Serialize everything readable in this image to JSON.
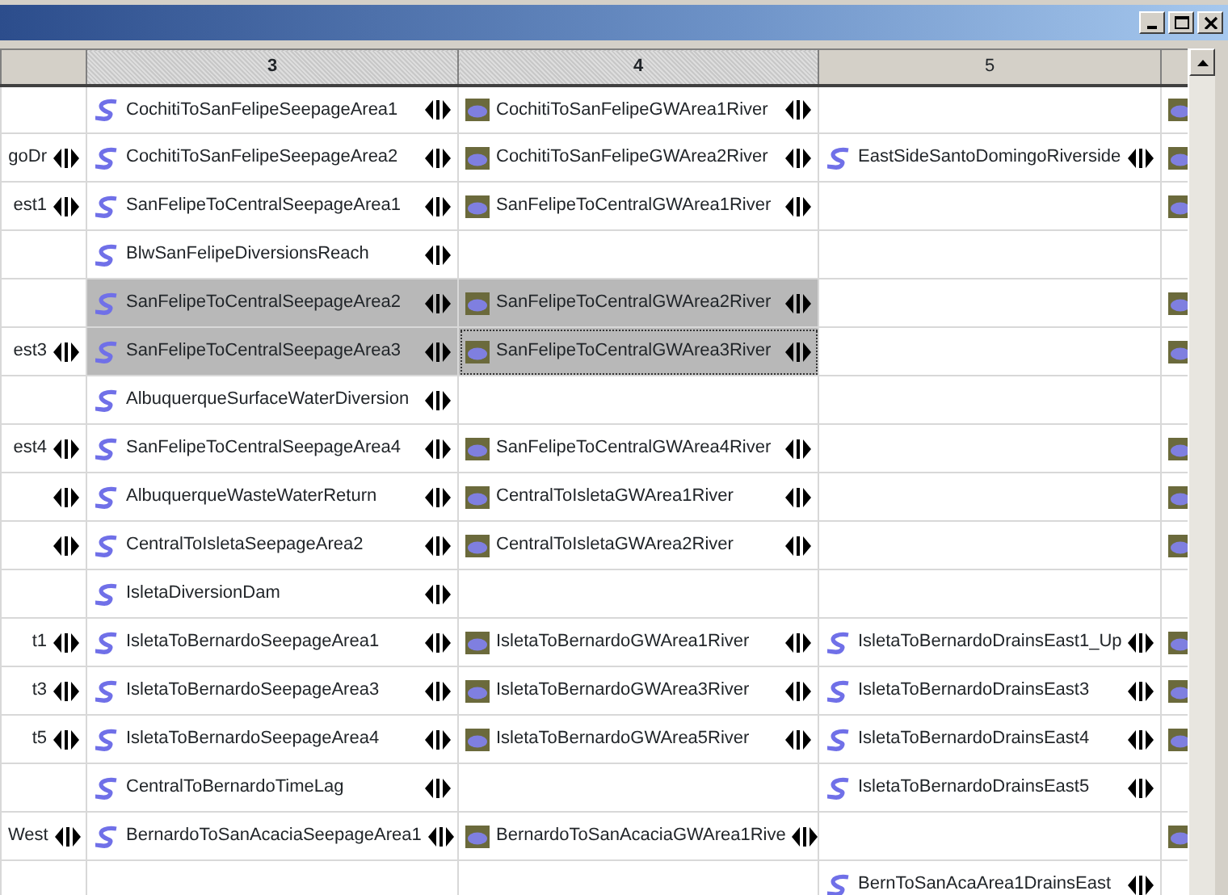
{
  "window": {
    "controls": [
      {
        "kind": "minimize"
      },
      {
        "kind": "maximize"
      },
      {
        "kind": "close"
      }
    ]
  },
  "table": {
    "columns": [
      {
        "selected": false
      },
      {
        "label": "3",
        "selected": true
      },
      {
        "label": "4",
        "selected": true
      },
      {
        "label": "5",
        "selected": false
      },
      {
        "selected": false
      }
    ],
    "rows": [
      {
        "cells": [
          {
            "kind": "empty",
            "selected": false,
            "focused": false
          },
          {
            "kind": "reach",
            "label": "CochitiToSanFelipeSeepageArea1",
            "selected": false,
            "focused": false
          },
          {
            "kind": "groundwater",
            "label": "CochitiToSanFelipeGWArea1River",
            "selected": false,
            "focused": false
          },
          {
            "kind": "empty",
            "selected": false,
            "focused": false
          },
          {
            "kind": "groundwater-icon",
            "selected": false,
            "focused": false
          }
        ]
      },
      {
        "cells": [
          {
            "kind": "text",
            "label": "goDr",
            "selected": false,
            "focused": false
          },
          {
            "kind": "reach",
            "label": "CochitiToSanFelipeSeepageArea2",
            "selected": false,
            "focused": false
          },
          {
            "kind": "groundwater",
            "label": "CochitiToSanFelipeGWArea2River",
            "selected": false,
            "focused": false
          },
          {
            "kind": "reach",
            "label": "EastSideSantoDomingoRiverside",
            "selected": false,
            "focused": false
          },
          {
            "kind": "groundwater-icon",
            "selected": false,
            "focused": false
          }
        ]
      },
      {
        "cells": [
          {
            "kind": "text",
            "label": "est1",
            "selected": false,
            "focused": false
          },
          {
            "kind": "reach",
            "label": "SanFelipeToCentralSeepageArea1",
            "selected": false,
            "focused": false
          },
          {
            "kind": "groundwater",
            "label": "SanFelipeToCentralGWArea1River",
            "selected": false,
            "focused": false
          },
          {
            "kind": "empty",
            "selected": false,
            "focused": false
          },
          {
            "kind": "groundwater-icon",
            "selected": false,
            "focused": false
          }
        ]
      },
      {
        "cells": [
          {
            "kind": "empty",
            "selected": false,
            "focused": false
          },
          {
            "kind": "reach",
            "label": "BlwSanFelipeDiversionsReach",
            "selected": false,
            "focused": false
          },
          {
            "kind": "empty",
            "selected": false,
            "focused": false
          },
          {
            "kind": "empty",
            "selected": false,
            "focused": false
          },
          {
            "kind": "empty",
            "selected": false,
            "focused": false
          }
        ]
      },
      {
        "cells": [
          {
            "kind": "empty",
            "selected": false,
            "focused": false
          },
          {
            "kind": "reach",
            "label": "SanFelipeToCentralSeepageArea2",
            "selected": true,
            "focused": false
          },
          {
            "kind": "groundwater",
            "label": "SanFelipeToCentralGWArea2River",
            "selected": true,
            "focused": false
          },
          {
            "kind": "empty",
            "selected": false,
            "focused": false
          },
          {
            "kind": "groundwater-icon",
            "selected": false,
            "focused": false
          }
        ]
      },
      {
        "cells": [
          {
            "kind": "text",
            "label": "est3",
            "selected": false,
            "focused": false
          },
          {
            "kind": "reach",
            "label": "SanFelipeToCentralSeepageArea3",
            "selected": true,
            "focused": false
          },
          {
            "kind": "groundwater",
            "label": "SanFelipeToCentralGWArea3River",
            "selected": true,
            "focused": true
          },
          {
            "kind": "empty",
            "selected": false,
            "focused": false
          },
          {
            "kind": "groundwater-icon",
            "selected": false,
            "focused": false
          }
        ]
      },
      {
        "cells": [
          {
            "kind": "empty",
            "selected": false,
            "focused": false
          },
          {
            "kind": "reach",
            "label": "AlbuquerqueSurfaceWaterDiversion",
            "selected": false,
            "focused": false
          },
          {
            "kind": "empty",
            "selected": false,
            "focused": false
          },
          {
            "kind": "empty",
            "selected": false,
            "focused": false
          },
          {
            "kind": "empty",
            "selected": false,
            "focused": false
          }
        ]
      },
      {
        "cells": [
          {
            "kind": "text",
            "label": "est4",
            "selected": false,
            "focused": false
          },
          {
            "kind": "reach",
            "label": "SanFelipeToCentralSeepageArea4",
            "selected": false,
            "focused": false
          },
          {
            "kind": "groundwater",
            "label": "SanFelipeToCentralGWArea4River",
            "selected": false,
            "focused": false
          },
          {
            "kind": "empty",
            "selected": false,
            "focused": false
          },
          {
            "kind": "groundwater-icon",
            "selected": false,
            "focused": false
          }
        ]
      },
      {
        "cells": [
          {
            "kind": "arrows",
            "selected": false,
            "focused": false
          },
          {
            "kind": "reach",
            "label": "AlbuquerqueWasteWaterReturn",
            "selected": false,
            "focused": false
          },
          {
            "kind": "groundwater",
            "label": "CentralToIsletaGWArea1River",
            "selected": false,
            "focused": false
          },
          {
            "kind": "empty",
            "selected": false,
            "focused": false
          },
          {
            "kind": "groundwater-icon",
            "selected": false,
            "focused": false
          }
        ]
      },
      {
        "cells": [
          {
            "kind": "arrows",
            "selected": false,
            "focused": false
          },
          {
            "kind": "reach",
            "label": "CentralToIsletaSeepageArea2",
            "selected": false,
            "focused": false
          },
          {
            "kind": "groundwater",
            "label": "CentralToIsletaGWArea2River",
            "selected": false,
            "focused": false
          },
          {
            "kind": "empty",
            "selected": false,
            "focused": false
          },
          {
            "kind": "groundwater-icon",
            "selected": false,
            "focused": false
          }
        ]
      },
      {
        "cells": [
          {
            "kind": "empty",
            "selected": false,
            "focused": false
          },
          {
            "kind": "reach",
            "label": "IsletaDiversionDam",
            "selected": false,
            "focused": false
          },
          {
            "kind": "empty",
            "selected": false,
            "focused": false
          },
          {
            "kind": "empty",
            "selected": false,
            "focused": false
          },
          {
            "kind": "empty",
            "selected": false,
            "focused": false
          }
        ]
      },
      {
        "cells": [
          {
            "kind": "text",
            "label": "t1",
            "selected": false,
            "focused": false
          },
          {
            "kind": "reach",
            "label": "IsletaToBernardoSeepageArea1",
            "selected": false,
            "focused": false
          },
          {
            "kind": "groundwater",
            "label": "IsletaToBernardoGWArea1River",
            "selected": false,
            "focused": false
          },
          {
            "kind": "reach",
            "label": "IsletaToBernardoDrainsEast1_Up",
            "selected": false,
            "focused": false
          },
          {
            "kind": "groundwater-icon",
            "selected": false,
            "focused": false
          }
        ]
      },
      {
        "cells": [
          {
            "kind": "text",
            "label": "t3",
            "selected": false,
            "focused": false
          },
          {
            "kind": "reach",
            "label": "IsletaToBernardoSeepageArea3",
            "selected": false,
            "focused": false
          },
          {
            "kind": "groundwater",
            "label": "IsletaToBernardoGWArea3River",
            "selected": false,
            "focused": false
          },
          {
            "kind": "reach",
            "label": "IsletaToBernardoDrainsEast3",
            "selected": false,
            "focused": false
          },
          {
            "kind": "groundwater-icon",
            "selected": false,
            "focused": false
          }
        ]
      },
      {
        "cells": [
          {
            "kind": "text",
            "label": "t5",
            "selected": false,
            "focused": false
          },
          {
            "kind": "reach",
            "label": "IsletaToBernardoSeepageArea4",
            "selected": false,
            "focused": false
          },
          {
            "kind": "groundwater",
            "label": "IsletaToBernardoGWArea5River",
            "selected": false,
            "focused": false
          },
          {
            "kind": "reach",
            "label": "IsletaToBernardoDrainsEast4",
            "selected": false,
            "focused": false
          },
          {
            "kind": "groundwater-icon",
            "selected": false,
            "focused": false
          }
        ]
      },
      {
        "cells": [
          {
            "kind": "empty",
            "selected": false,
            "focused": false
          },
          {
            "kind": "reach",
            "label": "CentralToBernardoTimeLag",
            "selected": false,
            "focused": false
          },
          {
            "kind": "empty",
            "selected": false,
            "focused": false
          },
          {
            "kind": "reach",
            "label": "IsletaToBernardoDrainsEast5",
            "selected": false,
            "focused": false
          },
          {
            "kind": "empty",
            "selected": false,
            "focused": false
          }
        ]
      },
      {
        "cells": [
          {
            "kind": "text",
            "label": "West",
            "selected": false,
            "focused": false
          },
          {
            "kind": "reach",
            "label": "BernardoToSanAcaciaSeepageArea1",
            "selected": false,
            "focused": false
          },
          {
            "kind": "groundwater",
            "label": "BernardoToSanAcaciaGWArea1Rive",
            "selected": false,
            "focused": false
          },
          {
            "kind": "empty",
            "selected": false,
            "focused": false
          },
          {
            "kind": "groundwater-icon",
            "selected": false,
            "focused": false
          }
        ]
      },
      {
        "cells": [
          {
            "kind": "empty",
            "selected": false,
            "focused": false
          },
          {
            "kind": "empty",
            "selected": false,
            "focused": false
          },
          {
            "kind": "empty",
            "selected": false,
            "focused": false
          },
          {
            "kind": "reach",
            "label": "BernToSanAcaArea1DrainsEast",
            "selected": false,
            "focused": false
          },
          {
            "kind": "empty",
            "selected": false,
            "focused": false
          }
        ]
      }
    ]
  }
}
